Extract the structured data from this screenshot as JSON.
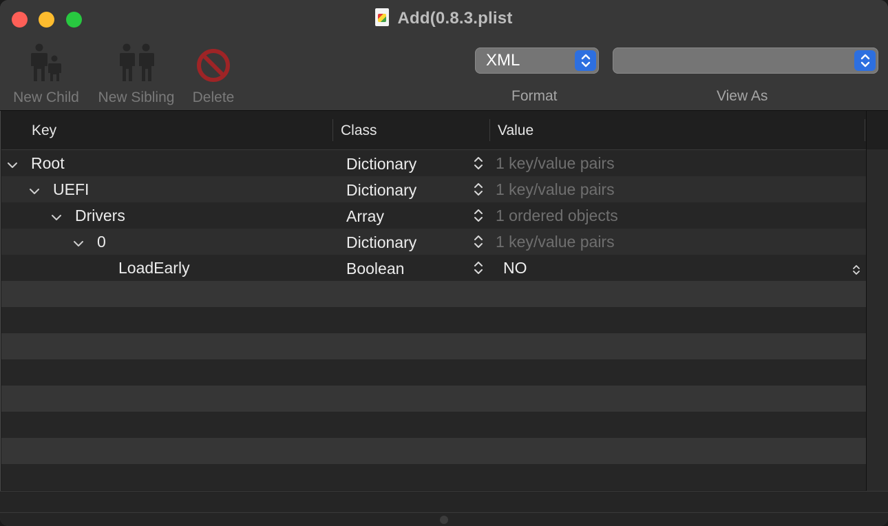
{
  "window": {
    "title": "Add(0.8.3.plist"
  },
  "toolbar": {
    "new_child_label": "New Child",
    "new_sibling_label": "New Sibling",
    "delete_label": "Delete",
    "format_value": "XML",
    "format_caption": "Format",
    "view_as_value": "",
    "view_as_caption": "View As"
  },
  "table": {
    "columns": {
      "key": "Key",
      "class": "Class",
      "value": "Value"
    },
    "rows": [
      {
        "key": "Root",
        "class": "Dictionary",
        "value": "1 key/value pairs"
      },
      {
        "key": "UEFI",
        "class": "Dictionary",
        "value": "1 key/value pairs"
      },
      {
        "key": "Drivers",
        "class": "Array",
        "value": "1 ordered objects"
      },
      {
        "key": "0",
        "class": "Dictionary",
        "value": "1 key/value pairs"
      },
      {
        "key": "LoadEarly",
        "class": "Boolean",
        "value": "NO"
      }
    ]
  },
  "colors": {
    "accent": "#2d6fe0",
    "close": "#fe5f57",
    "minimize": "#febc2e",
    "zoom": "#28c840",
    "delete_icon": "#b3282a"
  },
  "icons": [
    "new-child-icon",
    "new-sibling-icon",
    "delete-icon",
    "chevron-down-icon",
    "up-down-stepper-icon"
  ]
}
